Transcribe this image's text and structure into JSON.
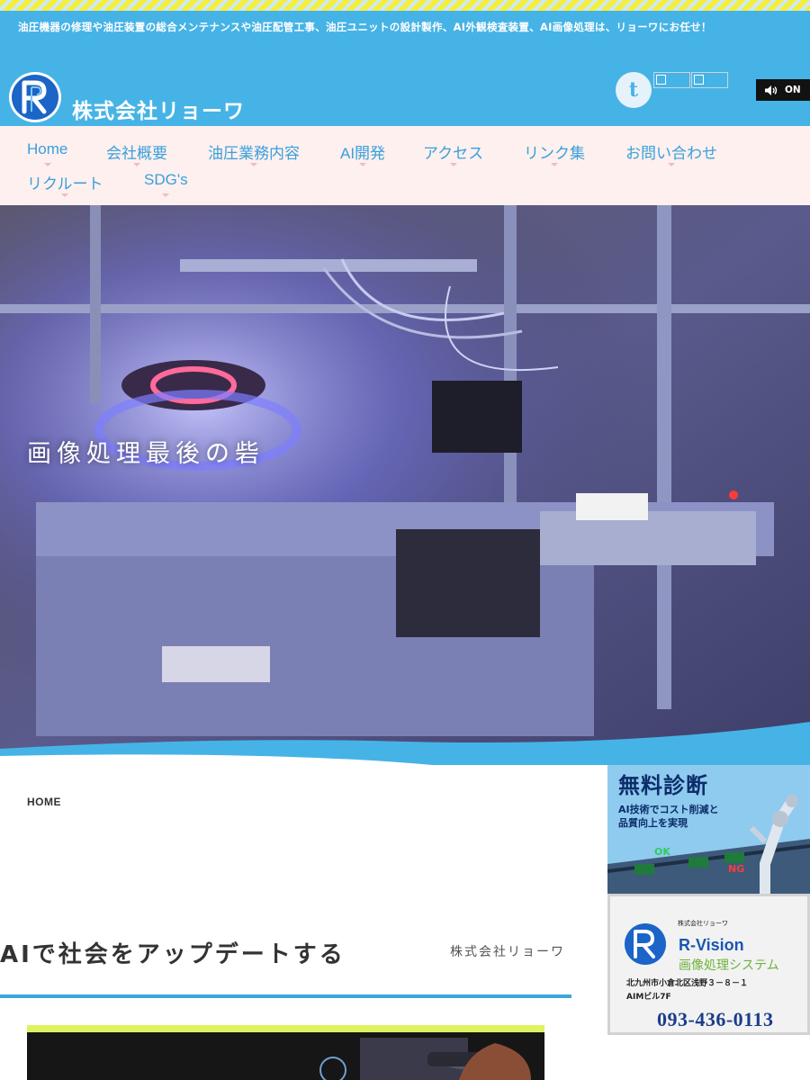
{
  "header": {
    "tagline": "油圧機器の修理や油圧装置の総合メンテナンスや油圧配管工事、油圧ユニットの設計製作、AI外観検査装置、AI画像処理は、リョーワにお任せ！",
    "company_name": "株式会社リョーワ",
    "logo_letter": "R",
    "social_icon_letter": "t",
    "sound_toggle": {
      "label": "ON",
      "icon": "speaker-icon"
    }
  },
  "nav": {
    "items": [
      {
        "label": "Home"
      },
      {
        "label": "会社概要"
      },
      {
        "label": "油圧業務内容"
      },
      {
        "label": "AI開発"
      },
      {
        "label": "アクセス"
      },
      {
        "label": "リンク集"
      },
      {
        "label": "お問い合わせ"
      },
      {
        "label": "リクルート"
      },
      {
        "label": "SDG's"
      }
    ]
  },
  "hero": {
    "caption": "画像処理最後の砦"
  },
  "breadcrumb": {
    "home": "HOME"
  },
  "main": {
    "title": "AIで社会をアップデートする",
    "subtitle": "株式会社リョーワ"
  },
  "sidebar": {
    "banner1": {
      "title": "無料診断",
      "line1": "AI技術でコスト削減と",
      "line2": "品質向上を実現",
      "ok_label": "OK",
      "ng_label": "NG"
    },
    "banner2": {
      "company": "株式会社リョーワ",
      "name": "R-Vision",
      "system": "画像処理システム",
      "address1": "北九州市小倉北区浅野３－８－１",
      "address2": "AIMビル7F",
      "phone": "093-436-0113"
    }
  },
  "colors": {
    "header_bg": "#46b3e6",
    "nav_bg": "#fdf0ee",
    "nav_text": "#3a9fdc",
    "accent_rule": "#3da6dc",
    "stripe_yellow": "#f4ee3c"
  }
}
